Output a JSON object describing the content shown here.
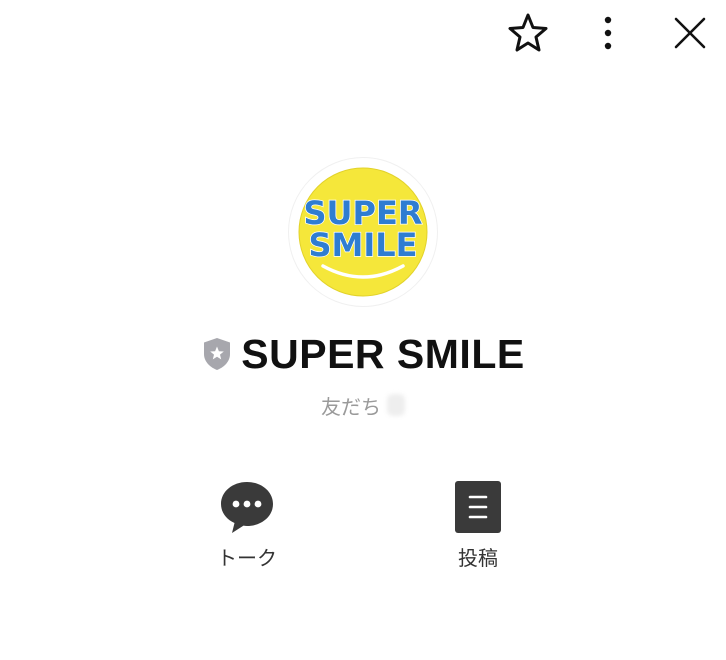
{
  "header": {
    "icons": [
      "star-icon",
      "more-vertical-icon",
      "close-icon"
    ]
  },
  "profile": {
    "avatar": {
      "logo_line1": "SUPER",
      "logo_line2": "SMILE",
      "colors": {
        "face": "#f5e73a",
        "text": "#2f7dd1"
      }
    },
    "name": "SUPER SMILE",
    "badge_icon": "shield-star-icon",
    "badge_color": "#a7a7ad",
    "friends_label": "友だち"
  },
  "actions": [
    {
      "label": "トーク",
      "icon": "chat-bubble-icon"
    },
    {
      "label": "投稿",
      "icon": "posts-icon"
    }
  ]
}
